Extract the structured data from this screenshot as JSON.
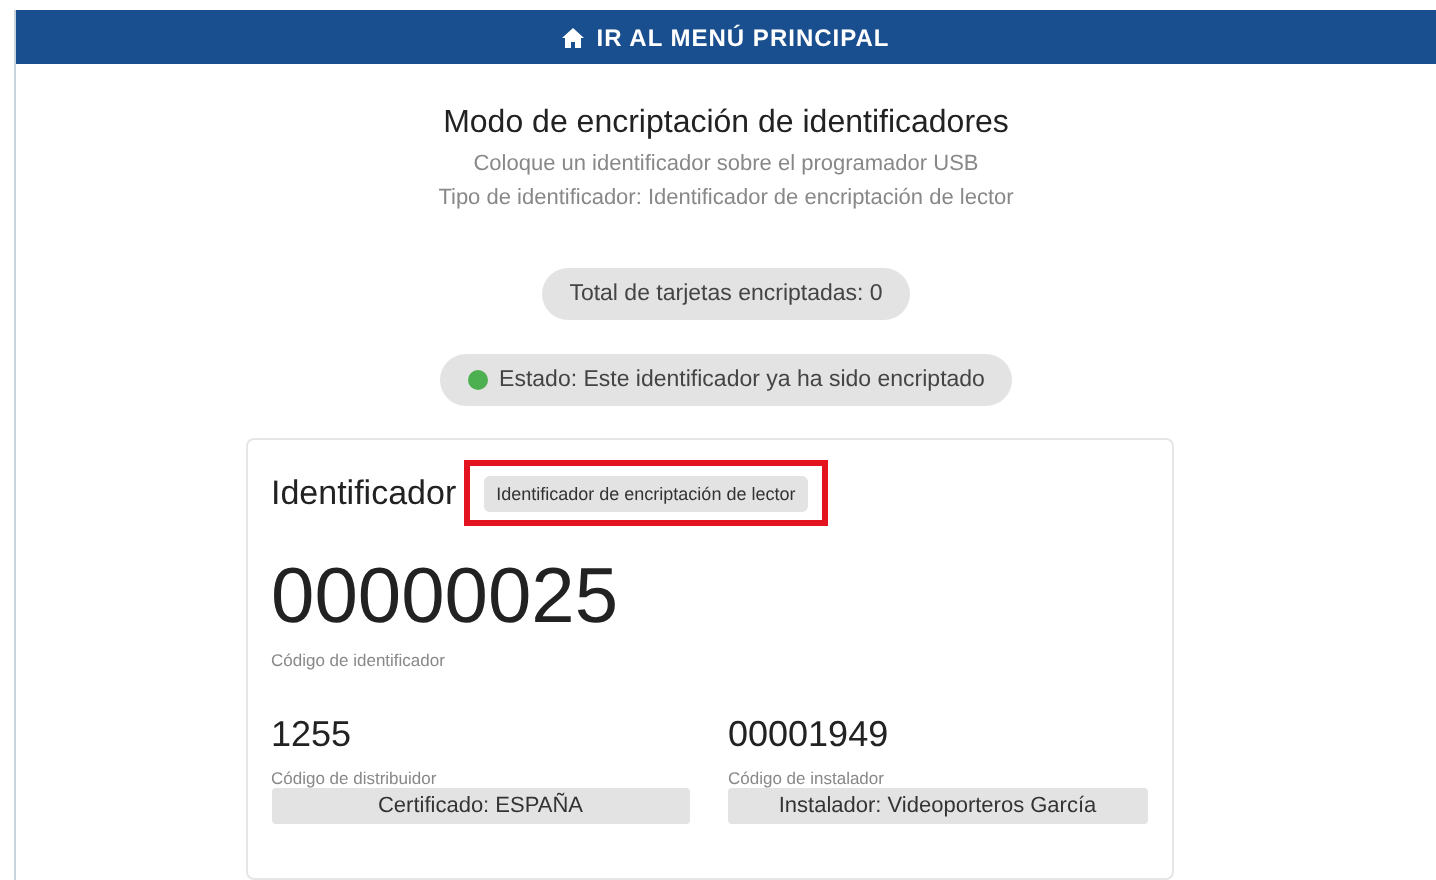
{
  "top_bar": {
    "label": "IR AL MENÚ PRINCIPAL"
  },
  "header": {
    "title": "Modo de encriptación de identificadores",
    "lines": [
      "Coloque un identificador sobre el programador USB",
      "Tipo de identificador: Identificador de encriptación de lector"
    ]
  },
  "counter": {
    "text": "Total de tarjetas encriptadas: 0"
  },
  "status": {
    "text": "Estado: Este identificador ya ha sido encriptado",
    "color": "#4caf50"
  },
  "card": {
    "title": "Identificador",
    "tag": {
      "text": "Identificador de encriptación de lector",
      "highlighted": true
    },
    "code": {
      "value": "00000025",
      "label": "Código de identificador"
    },
    "fields": [
      {
        "value": "1255",
        "label": "Código de distribuidor",
        "chip": "Certificado: ESPAÑA"
      },
      {
        "value": "00001949",
        "label": "Código de instalador",
        "chip": "Instalador: Videoporteros García"
      }
    ]
  }
}
